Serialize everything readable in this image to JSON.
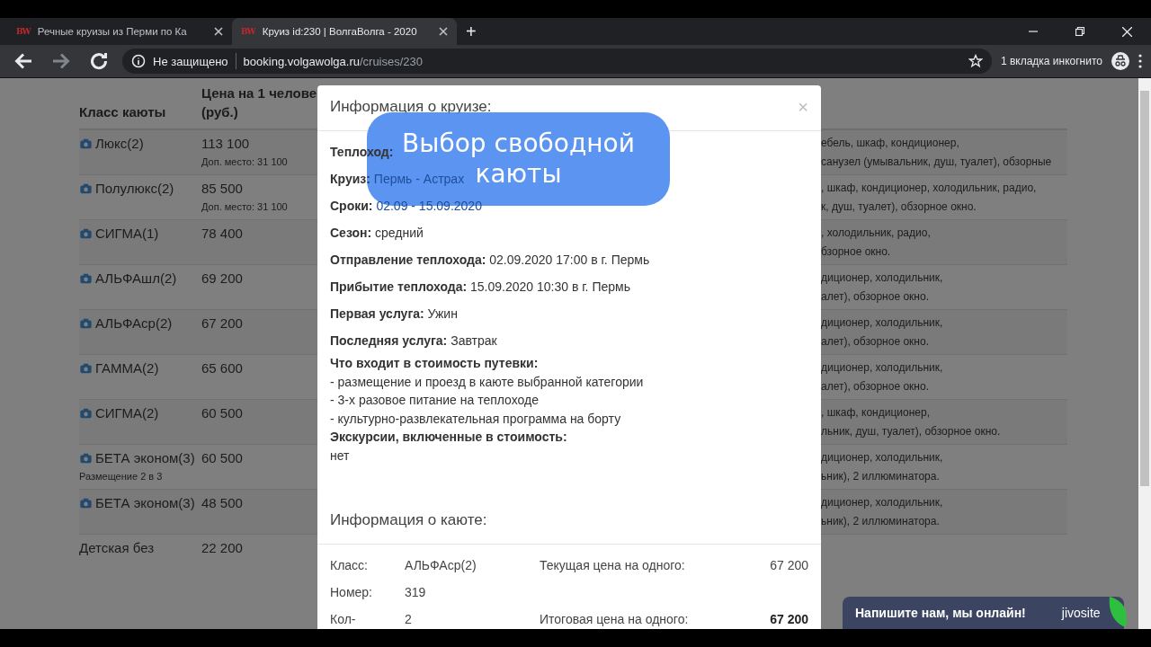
{
  "browser": {
    "tabs": [
      {
        "favicon": "BW",
        "title": "Речные круизы из Перми по Ка",
        "selected": false
      },
      {
        "favicon": "BW",
        "title": "Круиз id:230 | ВолгаВолга - 2020",
        "selected": true
      }
    ],
    "new_tab": "+",
    "nav": {
      "back_disabled": false,
      "forward_disabled": true
    },
    "security": "Не защищено",
    "url_host": "booking.volgawolga.ru",
    "url_path": "/cruises/230",
    "incognito": "1 вкладка инкогнито"
  },
  "table": {
    "columns": [
      "Класс каюты",
      "Цена на 1 челове\n(руб.)"
    ],
    "rows": [
      {
        "photo": true,
        "name": "Люкс(2)",
        "price": "113 100",
        "extra": "Доп. место: 31 100",
        "desc": [
          "ебель, шкаф, кондиционер,",
          "санузел (умывальник, душ, туалет), обзорные"
        ]
      },
      {
        "photo": true,
        "name": "Полулюкс(2)",
        "price": "85 500",
        "extra": "Доп. место: 31 100",
        "desc": [
          ", шкаф, кондиционер, холодильник, радио,",
          "к, душ, туалет), обзорное окно."
        ]
      },
      {
        "photo": true,
        "name": "СИГМА(1)",
        "price": "78 400",
        "desc": [
          ", холодильник, радио,",
          "бзорное окно."
        ]
      },
      {
        "photo": true,
        "name": "АЛЬФАшл(2)",
        "price": "69 200",
        "desc": [
          "диционер, холодильник,",
          "алет), обзорное окно."
        ]
      },
      {
        "photo": true,
        "name": "АЛЬФАср(2)",
        "price": "67 200",
        "desc": [
          "диционер, холодильник,",
          "алет), обзорное окно."
        ]
      },
      {
        "photo": true,
        "name": "ГАММА(2)",
        "price": "65 600",
        "desc": [
          "диционер, холодильник,",
          "алет), обзорное окно."
        ]
      },
      {
        "photo": true,
        "name": "СИГМА(2)",
        "price": "60 500",
        "desc": [
          ", шкаф, кондиционер,",
          "льник, душ, туалет), обзорное окно."
        ]
      },
      {
        "photo": true,
        "name": "БЕТА эконом(3)",
        "note": "Размещение 2 в 3",
        "price": "60 500",
        "desc": [
          "диционер, холодильник,",
          "ьник), 2 иллюминатора."
        ]
      },
      {
        "photo": true,
        "name": "БЕТА эконом(3)",
        "price": "48 500",
        "desc": [
          "диционер, холодильник,",
          "ьник), 2 иллюминатора."
        ]
      },
      {
        "photo": false,
        "name": "Детская без",
        "price": "22 200",
        "desc": []
      }
    ]
  },
  "modal": {
    "title": "Информация о круизе:",
    "close": "×",
    "fields": [
      {
        "kind": "field",
        "label": "Теплоход:"
      },
      {
        "kind": "link",
        "label": "Круиз:",
        "value": "Пермь - Астрах"
      },
      {
        "kind": "link",
        "label": "Сроки:",
        "value": "02.09 - 15.09.2020"
      },
      {
        "kind": "field",
        "label": "Сезон:",
        "value": "средний"
      },
      {
        "kind": "field",
        "label": "Отправление теплохода:",
        "value": "02.09.2020 17:00 в г. Пермь"
      },
      {
        "kind": "field",
        "label": "Прибытие теплохода:",
        "value": "15.09.2020 10:30 в г. Пермь"
      },
      {
        "kind": "field",
        "label": "Первая услуга:",
        "value": "Ужин"
      },
      {
        "kind": "field",
        "label": "Последняя услуга:",
        "value": "Завтрак"
      }
    ],
    "included_title": "Что входит в стоимость путевки:",
    "included": [
      "- размещение и проезд в каюте выбранной категории",
      "- 3-х разовое питание на теплоходе",
      "- культурно-развлекательная программа на борту"
    ],
    "excursions_title": "Экскурсии, включенные в стоимость:",
    "excursions": "нет",
    "cabin_title": "Информация о каюте:",
    "cabin": [
      {
        "label": "Класс:",
        "value": "АЛЬФАср(2)",
        "price_label": "Текущая цена на одного:",
        "price": "67 200",
        "bold": false
      },
      {
        "label": "Номер:",
        "value": "319"
      },
      {
        "label": "Кол-",
        "value": "2",
        "price_label": "Итоговая цена на одного:",
        "price": "67 200",
        "bold": true
      }
    ]
  },
  "callout": "Выбор свободной каюты",
  "chat": {
    "text": "Напишите нам, мы онлайн!",
    "brand": "jivosite"
  }
}
